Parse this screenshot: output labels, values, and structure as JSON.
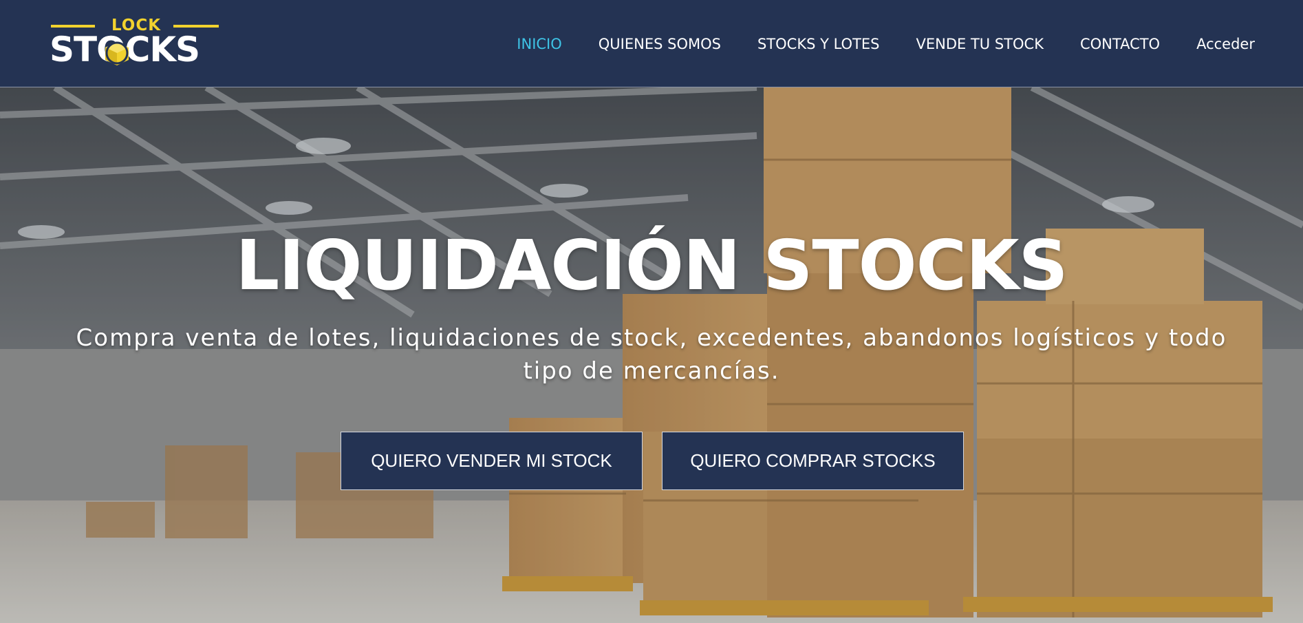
{
  "logo": {
    "top_text": "LOCK",
    "main_text": "STOCKS",
    "colors": {
      "yellow": "#f2d22e",
      "white": "#ffffff"
    }
  },
  "nav": {
    "items": [
      {
        "label": "INICIO",
        "active": true
      },
      {
        "label": "QUIENES SOMOS",
        "active": false
      },
      {
        "label": "STOCKS Y LOTES",
        "active": false
      },
      {
        "label": "VENDE TU STOCK",
        "active": false
      },
      {
        "label": "CONTACTO",
        "active": false
      },
      {
        "label": "Acceder",
        "active": false
      }
    ],
    "colors": {
      "background": "#243353",
      "active": "#3ec4e6"
    }
  },
  "hero": {
    "title": "LIQUIDACIÓN STOCKS",
    "subtitle_line1": "Compra venta de lotes, liquidaciones de stock, excedentes, abandonos logísticos y todo",
    "subtitle_line2": "tipo de mercancías.",
    "buttons": {
      "sell": "QUIERO VENDER MI STOCK",
      "buy": "QUIERO COMPRAR STOCKS"
    },
    "background_icon": "warehouse-boxes-image"
  }
}
